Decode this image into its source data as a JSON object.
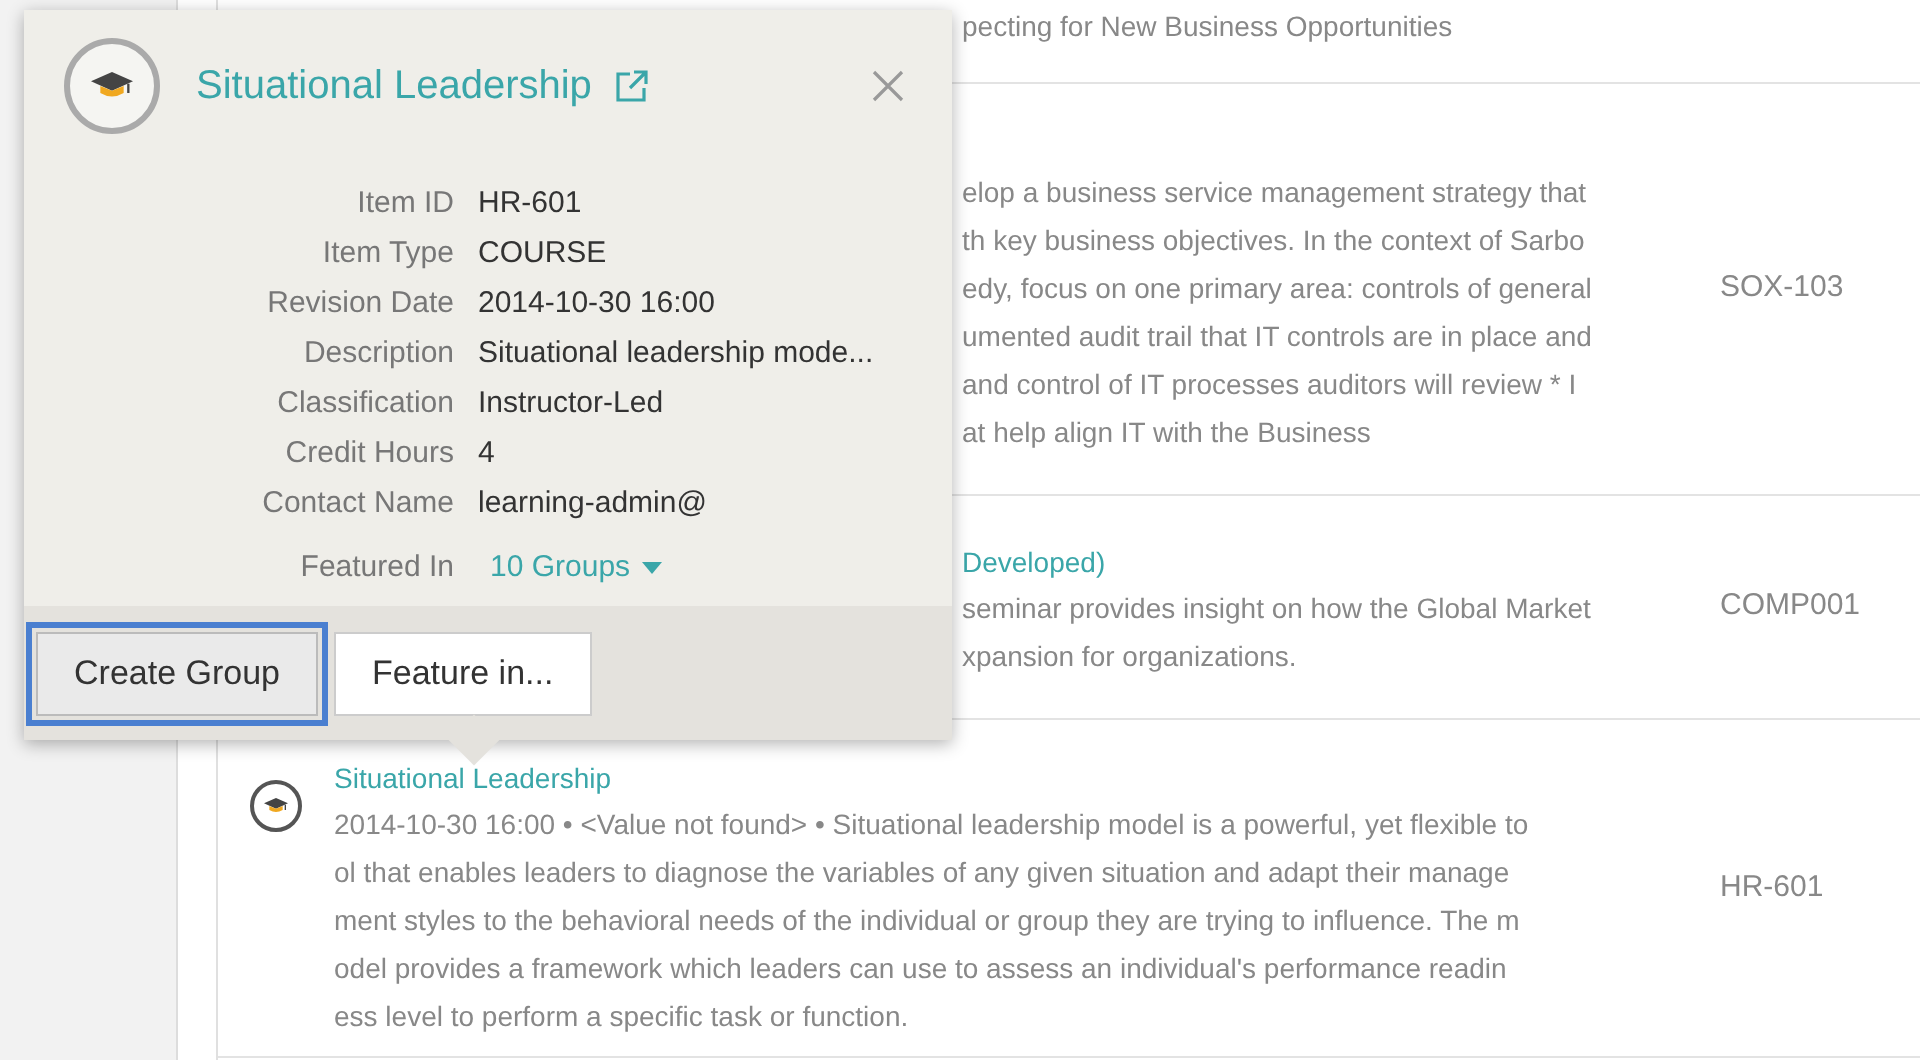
{
  "results": [
    {
      "kind": "partial",
      "lines": [
        "pecting for New Business Opportunities"
      ]
    },
    {
      "kind": "partial",
      "lines": [
        "elop a business service management strategy that",
        "th key business objectives. In the context of Sarbo",
        "edy, focus on one primary area: controls of general",
        "umented audit trail that IT controls are in place and",
        "and control of IT processes auditors will review * I",
        "at help align IT with the Business"
      ],
      "code": "SOX-103"
    },
    {
      "kind": "partial",
      "title": "Developed)",
      "lines": [
        "seminar provides insight on how the Global Market",
        "xpansion for organizations."
      ],
      "code": "COMP001"
    },
    {
      "kind": "course",
      "title": "Situational Leadership",
      "lines": [
        "2014-10-30 16:00 • <Value not found> • Situational leadership model is a powerful, yet flexible to",
        "ol that enables leaders to diagnose the variables of any given situation and adapt their manage",
        "ment styles to the behavioral needs of the individual or group they are trying to influence. The m",
        "odel provides a framework which leaders can use to assess an individual's performance readin",
        "ess level to perform a specific task or function."
      ],
      "code": "HR-601"
    }
  ],
  "popover": {
    "title": "Situational Leadership",
    "fields": [
      {
        "label": "Item ID",
        "value": "HR-601"
      },
      {
        "label": "Item Type",
        "value": "COURSE"
      },
      {
        "label": "Revision Date",
        "value": "2014-10-30 16:00"
      },
      {
        "label": "Description",
        "value": "Situational leadership mode..."
      },
      {
        "label": "Classification",
        "value": "Instructor-Led"
      },
      {
        "label": "Credit Hours",
        "value": "4"
      },
      {
        "label": "Contact Name",
        "value": "learning-admin@"
      }
    ],
    "featured": {
      "label": "Featured In",
      "value": "10 Groups"
    },
    "buttons": [
      {
        "label": "Create Group",
        "focused": true
      },
      {
        "label": "Feature in...",
        "focused": false
      }
    ]
  }
}
